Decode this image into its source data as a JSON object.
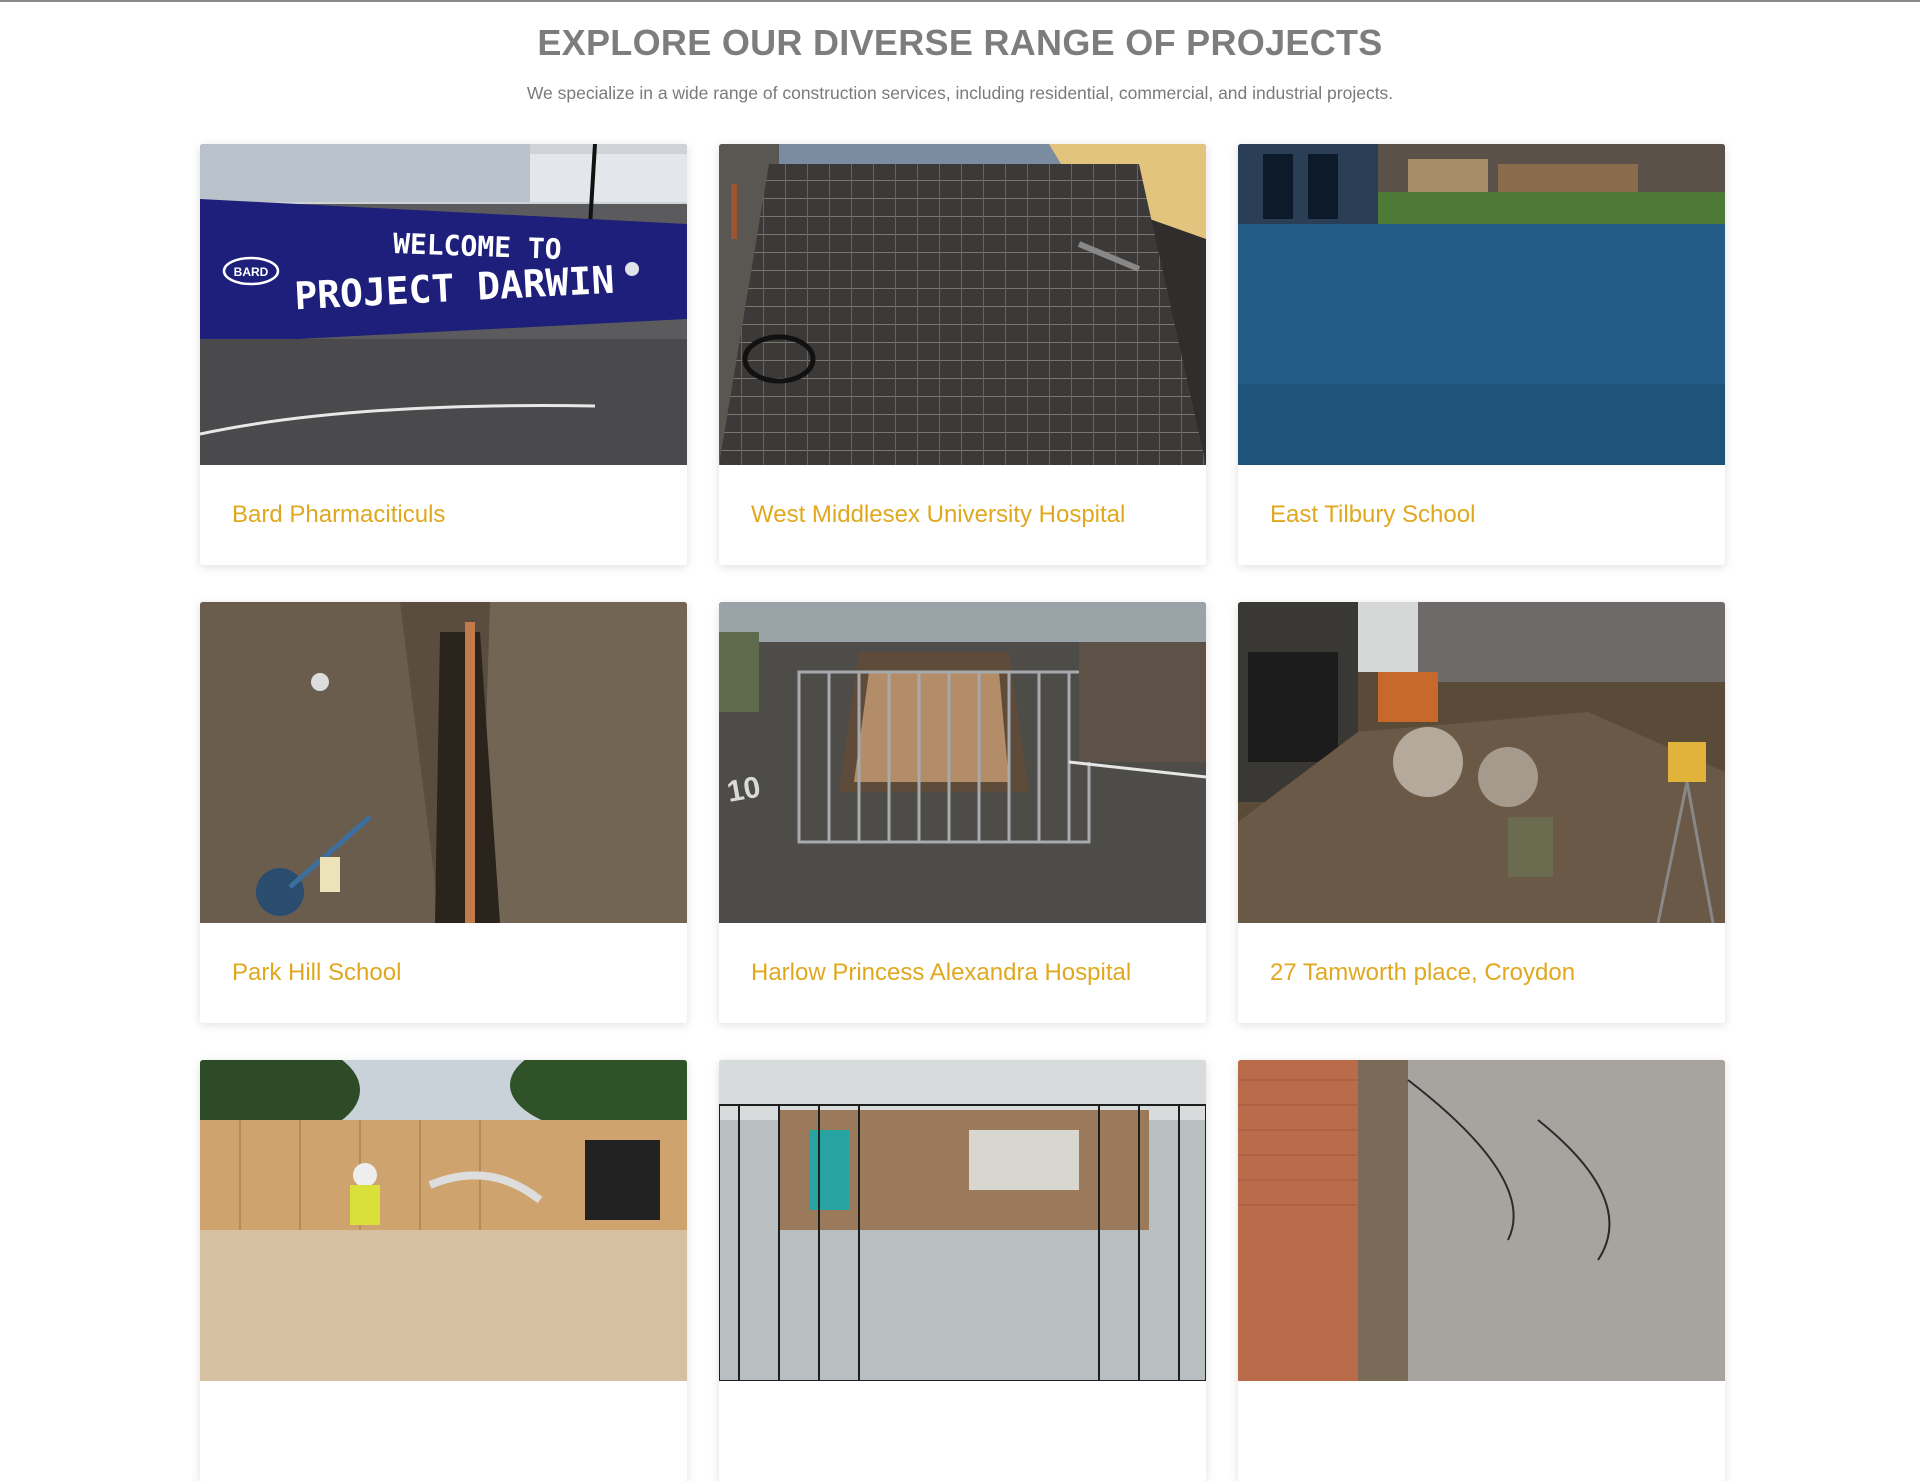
{
  "section": {
    "title": "EXPLORE OUR DIVERSE RANGE OF PROJECTS",
    "subtitle": "We specialize in a wide range of construction services, including residential, commercial, and industrial projects."
  },
  "projects": [
    {
      "title": "Bard Pharmaciticuls",
      "image_text": {
        "line1": "WELCOME TO",
        "line2": "PROJECT DARWIN",
        "logo": "BARD"
      }
    },
    {
      "title": "West Middlesex University Hospital"
    },
    {
      "title": "East Tilbury School"
    },
    {
      "title": "Park Hill School"
    },
    {
      "title": "Harlow Princess Alexandra Hospital"
    },
    {
      "title": "27 Tamworth place, Croydon"
    },
    {
      "title": ""
    },
    {
      "title": ""
    },
    {
      "title": ""
    }
  ],
  "colors": {
    "heading": "#7d7d7d",
    "card_title": "#e0a81e"
  }
}
